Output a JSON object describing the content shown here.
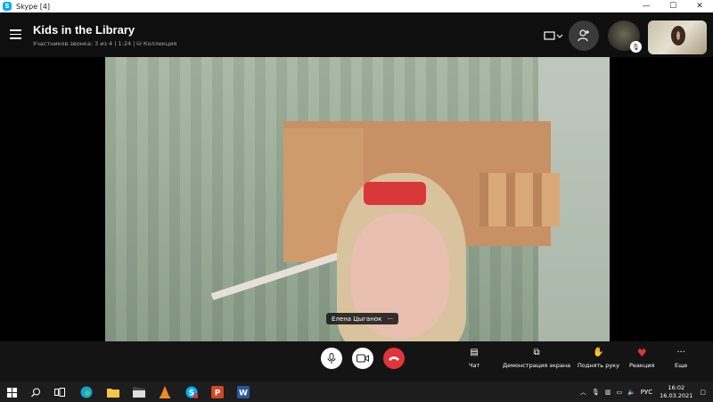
{
  "window": {
    "title": "Skype [4]",
    "controls": {
      "minimize": "—",
      "maximize": "☐",
      "close": "✕"
    }
  },
  "call": {
    "title": "Kids in the Library",
    "subtitle": "Участников звонка: 3 из 4 | 1:24 | ⛁ Коллекция",
    "participant_name": "Елена Цыганок",
    "participant_menu": "···"
  },
  "header_icons": [
    "menu-icon",
    "layout-icon",
    "add-person-icon",
    "mic-icon"
  ],
  "toolbar": {
    "items": [
      {
        "icon": "▤",
        "label": "Чат"
      },
      {
        "icon": "⧉",
        "label": "Демонстрация экрана"
      },
      {
        "icon": "✋",
        "label": "Поднять руку"
      },
      {
        "icon": "♥",
        "label": "Реакция"
      },
      {
        "icon": "···",
        "label": "Еще"
      }
    ],
    "buttons": {
      "mic": "🎙",
      "video": "▭",
      "hangup": "☎"
    }
  },
  "taskbar": {
    "language": "РУС",
    "time": "16:02",
    "date": "16.03.2021",
    "apps": [
      "start-icon",
      "search-icon",
      "task-view-icon",
      "edge-icon",
      "explorer-icon",
      "clapper-icon",
      "vlc-icon",
      "skype-icon",
      "powerpoint-icon",
      "word-icon"
    ]
  },
  "colors": {
    "accent": "#00aff0",
    "hangup": "#e0343a",
    "reaction": "#e0343a"
  }
}
